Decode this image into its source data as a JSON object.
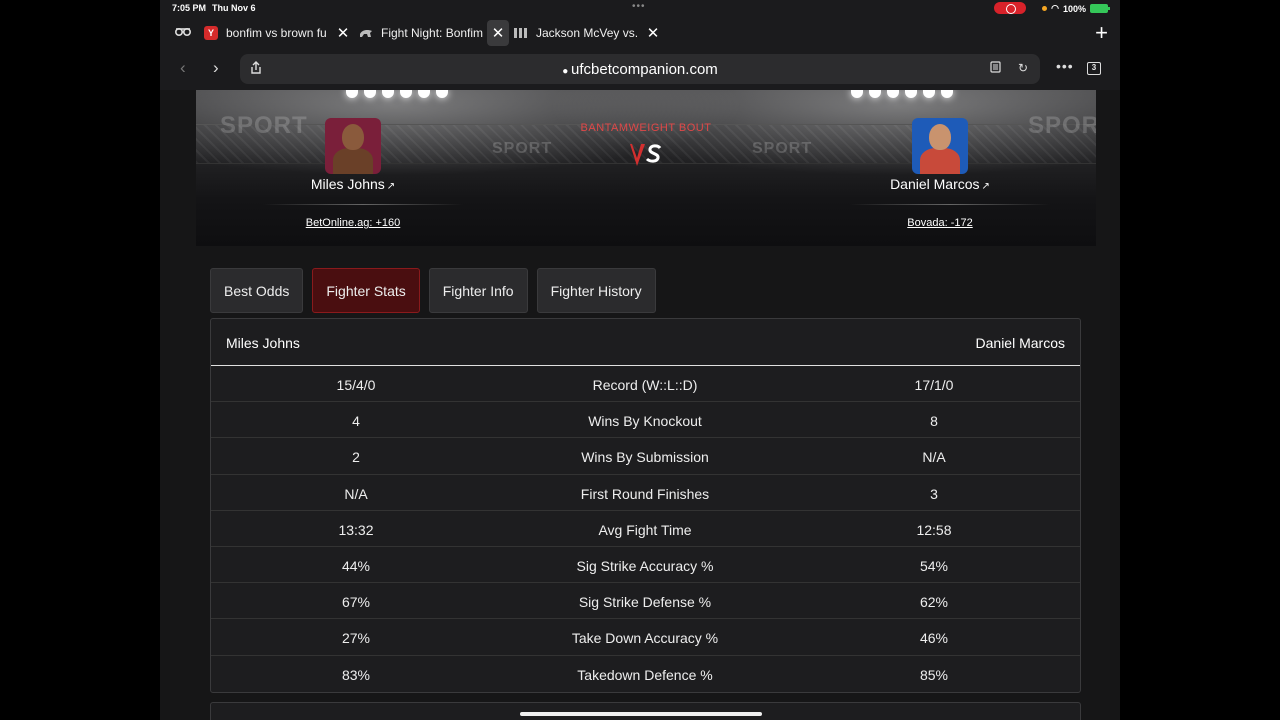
{
  "status": {
    "time": "7:05 PM",
    "date": "Thu Nov 6",
    "battery": "100%"
  },
  "tabs": [
    {
      "title": "bonfim vs brown fu",
      "favicon": "Y",
      "favicon_color": "#d62b2b",
      "active": false
    },
    {
      "title": "Fight Night: Bonfim",
      "favicon": "cheetah-icon",
      "active": true
    },
    {
      "title": "Jackson McVey vs.",
      "favicon": "grid-icon",
      "active": false
    }
  ],
  "url": "ufcbetcompanion.com",
  "tab_count": "3",
  "hero": {
    "bout_label": "BANTAMWEIGHT BOUT",
    "vs_text": "VS",
    "fighter1": {
      "name": "Miles Johns",
      "odds": "BetOnline.ag: +160",
      "avatar_color": "#7a1f3a"
    },
    "fighter2": {
      "name": "Daniel Marcos",
      "odds": "Bovada: -172",
      "avatar_color": "#1e5bb8"
    }
  },
  "section_tabs": [
    {
      "label": "Best Odds",
      "active": false
    },
    {
      "label": "Fighter Stats",
      "active": true
    },
    {
      "label": "Fighter Info",
      "active": false
    },
    {
      "label": "Fighter History",
      "active": false
    }
  ],
  "stats": {
    "left_header": "Miles Johns",
    "right_header": "Daniel Marcos",
    "rows": [
      {
        "left": "15/4/0",
        "label": "Record (W::L::D)",
        "right": "17/1/0"
      },
      {
        "left": "4",
        "label": "Wins By Knockout",
        "right": "8"
      },
      {
        "left": "2",
        "label": "Wins By Submission",
        "right": "N/A"
      },
      {
        "left": "N/A",
        "label": "First Round Finishes",
        "right": "3"
      },
      {
        "left": "13:32",
        "label": "Avg Fight Time",
        "right": "12:58"
      },
      {
        "left": "44%",
        "label": "Sig Strike Accuracy %",
        "right": "54%"
      },
      {
        "left": "67%",
        "label": "Sig Strike Defense %",
        "right": "62%"
      },
      {
        "left": "27%",
        "label": "Take Down Accuracy %",
        "right": "46%"
      },
      {
        "left": "83%",
        "label": "Takedown Defence %",
        "right": "85%"
      }
    ]
  },
  "colors": {
    "accent_red": "#e04848",
    "active_tab_bg": "#4a0e10"
  }
}
